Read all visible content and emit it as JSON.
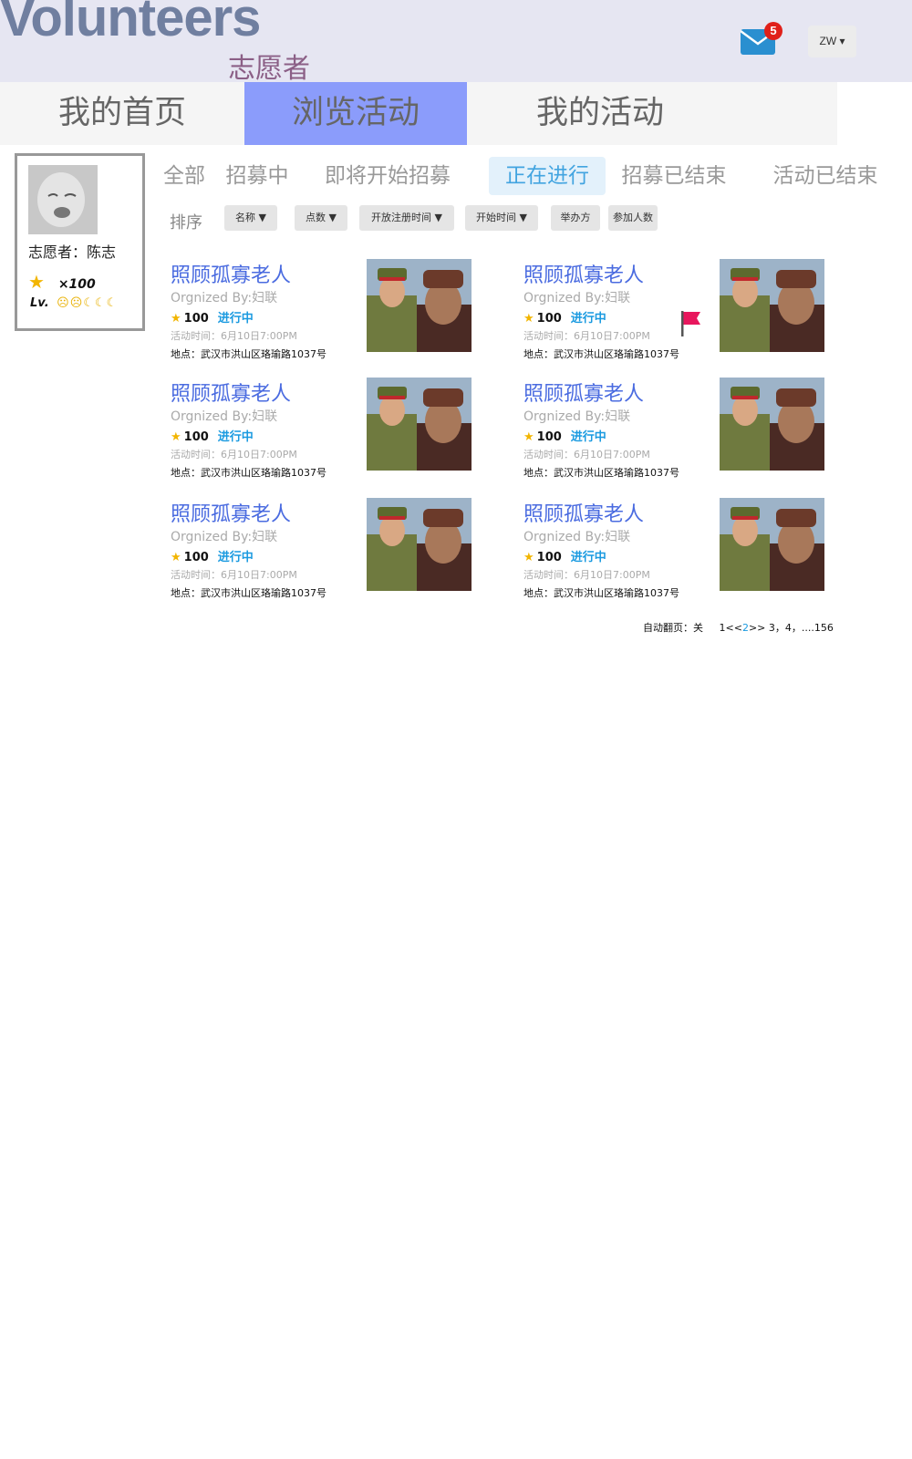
{
  "header": {
    "logo_main": "Volunteers",
    "logo_sub": "志愿者",
    "mail_count": "5",
    "user_label": "ZW"
  },
  "nav": {
    "tabs": [
      {
        "label": "我的首页"
      },
      {
        "label": "浏览活动"
      },
      {
        "label": "我的活动"
      }
    ],
    "active_index": 1
  },
  "profile": {
    "name_line": "志愿者：陈志",
    "points": "×100",
    "level_label": "Lv."
  },
  "filters": {
    "tabs": [
      "全部",
      "招募中",
      "即将开始招募",
      "正在进行",
      "招募已结束",
      "活动已结束"
    ],
    "active_index": 3
  },
  "sort": {
    "label": "排序",
    "buttons": [
      "名称",
      "点数",
      "开放注册时间",
      "开始时间",
      "举办方",
      "参加人数"
    ]
  },
  "activities": [
    {
      "title": "照顾孤寡老人",
      "org": "Orgnized By:妇联",
      "points": "100",
      "status": "进行中",
      "time": "活动时间：6月10日7:00PM",
      "location": "地点：武汉市洪山区珞瑜路1037号"
    },
    {
      "title": "照顾孤寡老人",
      "org": "Orgnized By:妇联",
      "points": "100",
      "status": "进行中",
      "time": "活动时间：6月10日7:00PM",
      "location": "地点：武汉市洪山区珞瑜路1037号"
    },
    {
      "title": "照顾孤寡老人",
      "org": "Orgnized By:妇联",
      "points": "100",
      "status": "进行中",
      "time": "活动时间：6月10日7:00PM",
      "location": "地点：武汉市洪山区珞瑜路1037号"
    },
    {
      "title": "照顾孤寡老人",
      "org": "Orgnized By:妇联",
      "points": "100",
      "status": "进行中",
      "time": "活动时间：6月10日7:00PM",
      "location": "地点：武汉市洪山区珞瑜路1037号"
    },
    {
      "title": "照顾孤寡老人",
      "org": "Orgnized By:妇联",
      "points": "100",
      "status": "进行中",
      "time": "活动时间：6月10日7:00PM",
      "location": "地点：武汉市洪山区珞瑜路1037号"
    },
    {
      "title": "照顾孤寡老人",
      "org": "Orgnized By:妇联",
      "points": "100",
      "status": "进行中",
      "time": "活动时间：6月10日7:00PM",
      "location": "地点：武汉市洪山区珞瑜路1037号"
    }
  ],
  "pager": {
    "auto_label": "自动翻页：关",
    "first": "1",
    "prev": "<<",
    "current": "2",
    "next": ">>",
    "rest": "3，4，....156"
  },
  "colors": {
    "nav_active": "#8b9cfb",
    "title_blue": "#4a6be0",
    "status_blue": "#1a9ae0",
    "badge_red": "#e0201a",
    "flag_red": "#e8175d"
  }
}
